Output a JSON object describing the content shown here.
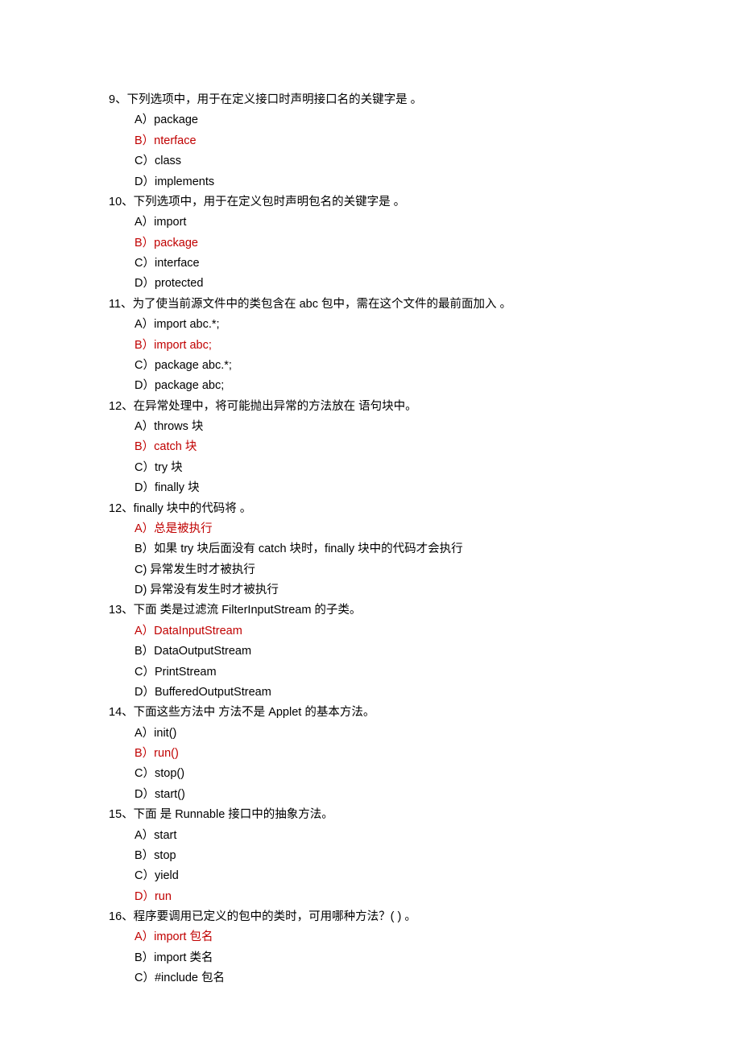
{
  "questions": [
    {
      "num": "9、",
      "stem": "下列选项中，用于在定义接口时声明接口名的关键字是 。",
      "options": [
        {
          "label": "A）package",
          "red": false
        },
        {
          "label": "B）nterface",
          "red": true
        },
        {
          "label": "C）class",
          "red": false
        },
        {
          "label": "D）implements",
          "red": false
        }
      ]
    },
    {
      "num": "10、",
      "stem": "下列选项中，用于在定义包时声明包名的关键字是 。",
      "options": [
        {
          "label": "A）import",
          "red": false
        },
        {
          "label": "B）package",
          "red": true
        },
        {
          "label": "C）interface",
          "red": false
        },
        {
          "label": "D）protected",
          "red": false
        }
      ]
    },
    {
      "num": "11、",
      "stem": "为了使当前源文件中的类包含在 abc 包中，需在这个文件的最前面加入 。",
      "options": [
        {
          "label": "A）import abc.*;",
          "red": false
        },
        {
          "label": "B）import abc;",
          "red": true
        },
        {
          "label": "C）package abc.*;",
          "red": false
        },
        {
          "label": "D）package abc;",
          "red": false
        }
      ]
    },
    {
      "num": "12、",
      "stem": "在异常处理中，将可能抛出异常的方法放在 语句块中。",
      "options": [
        {
          "label": "A）throws 块",
          "red": false
        },
        {
          "label": "B）catch 块",
          "red": true
        },
        {
          "label": "C）try 块",
          "red": false
        },
        {
          "label": "D）finally 块",
          "red": false
        }
      ]
    },
    {
      "num": "12、",
      "stem": "finally 块中的代码将 。",
      "options": [
        {
          "label": "A）总是被执行",
          "red": true
        },
        {
          "label": "B）如果 try 块后面没有 catch 块时，finally 块中的代码才会执行",
          "red": false
        },
        {
          "label": "C) 异常发生时才被执行",
          "red": false
        },
        {
          "label": "D) 异常没有发生时才被执行",
          "red": false
        }
      ]
    },
    {
      "num": "13、",
      "stem": "下面 类是过滤流 FilterInputStream 的子类。",
      "options": [
        {
          "label": "A）DataInputStream",
          "red": true
        },
        {
          "label": "B）DataOutputStream",
          "red": false
        },
        {
          "label": "C）PrintStream",
          "red": false
        },
        {
          "label": "D）BufferedOutputStream",
          "red": false
        }
      ]
    },
    {
      "num": "14、",
      "stem": "下面这些方法中 方法不是 Applet 的基本方法。",
      "options": [
        {
          "label": "A）init()",
          "red": false
        },
        {
          "label": "B）run()",
          "red": true
        },
        {
          "label": "C）stop()",
          "red": false
        },
        {
          "label": "D）start()",
          "red": false
        }
      ]
    },
    {
      "num": "15、",
      "stem": "下面 是 Runnable 接口中的抽象方法。",
      "options": [
        {
          "label": "A）start",
          "red": false
        },
        {
          "label": "B）stop",
          "red": false
        },
        {
          "label": "C）yield",
          "red": false
        },
        {
          "label": "D）run",
          "red": true
        }
      ]
    },
    {
      "num": "16、",
      "stem": "程序要调用已定义的包中的类时，可用哪种方法？( ) 。",
      "options": [
        {
          "label": "A）import 包名",
          "red": true
        },
        {
          "label": "B）import 类名",
          "red": false
        },
        {
          "label": "C）#include 包名",
          "red": false
        }
      ]
    }
  ]
}
